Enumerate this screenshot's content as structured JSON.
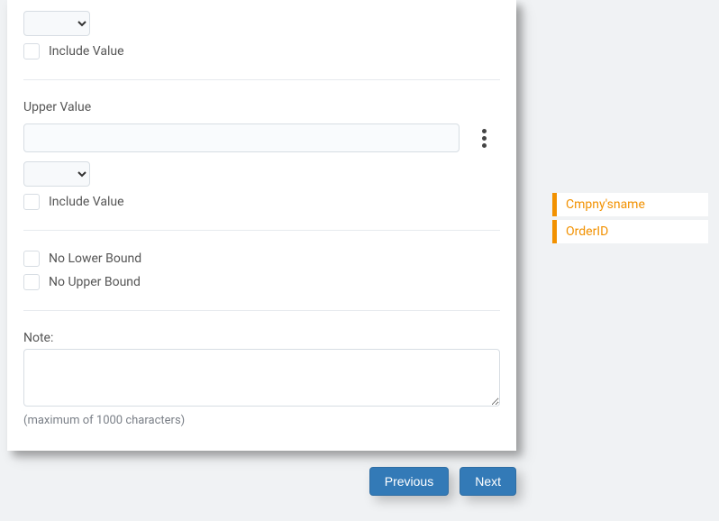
{
  "form": {
    "include_value_label_1": "Include Value",
    "upper_value_label": "Upper Value",
    "include_value_label_2": "Include Value",
    "no_lower_bound_label": "No Lower Bound",
    "no_upper_bound_label": "No Upper Bound",
    "note_label": "Note:",
    "note_hint": "(maximum of 1000 characters)",
    "upper_value": "",
    "note_value": ""
  },
  "buttons": {
    "previous": "Previous",
    "next": "Next"
  },
  "sidebar": {
    "items": [
      {
        "label": "Cmpny'sname"
      },
      {
        "label": "OrderID"
      }
    ]
  }
}
